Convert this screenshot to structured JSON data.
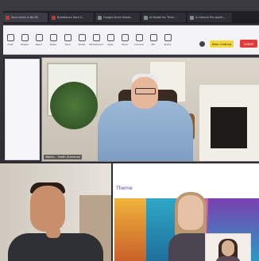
{
  "browser": {
    "tabs": [
      {
        "label": "Sora video is Ne Mt",
        "color": "#c0392b"
      },
      {
        "label": "Bytedance Sora 2...",
        "color": "#c0392b"
      },
      {
        "label": "Google Drive Sheet...",
        "color": "#7f8c8d"
      },
      {
        "label": "AI Model for Time...",
        "color": "#7f8c8d"
      },
      {
        "label": "Is OpenAI Pro worth...",
        "color": "#7f8c8d"
      },
      {
        "label": "AI Use Cases Plan...",
        "color": "#2d6cdf"
      }
    ]
  },
  "toolbar": {
    "buttons": [
      {
        "label": "Chat",
        "icon": "chat-icon"
      },
      {
        "label": "People",
        "icon": "people-icon"
      },
      {
        "label": "React",
        "icon": "react-icon"
      },
      {
        "label": "Raise",
        "icon": "raise-icon"
      },
      {
        "label": "View",
        "icon": "view-icon"
      },
      {
        "label": "Notes",
        "icon": "notes-icon"
      },
      {
        "label": "Whiteboard",
        "icon": "whiteboard-icon"
      },
      {
        "label": "Apps",
        "icon": "apps-icon"
      },
      {
        "label": "More",
        "icon": "more-icon"
      },
      {
        "label": "Camera",
        "icon": "camera-icon"
      },
      {
        "label": "Mic",
        "icon": "mic-icon"
      },
      {
        "label": "Share",
        "icon": "share-icon"
      }
    ],
    "yellow_label": "Keep chatting",
    "leave_label": "Leave"
  },
  "participants": [
    {
      "name": "Walter... Smith (External)"
    },
    {
      "name": ""
    },
    {
      "name": ""
    }
  ],
  "shared_content": {
    "title": "Theme"
  }
}
